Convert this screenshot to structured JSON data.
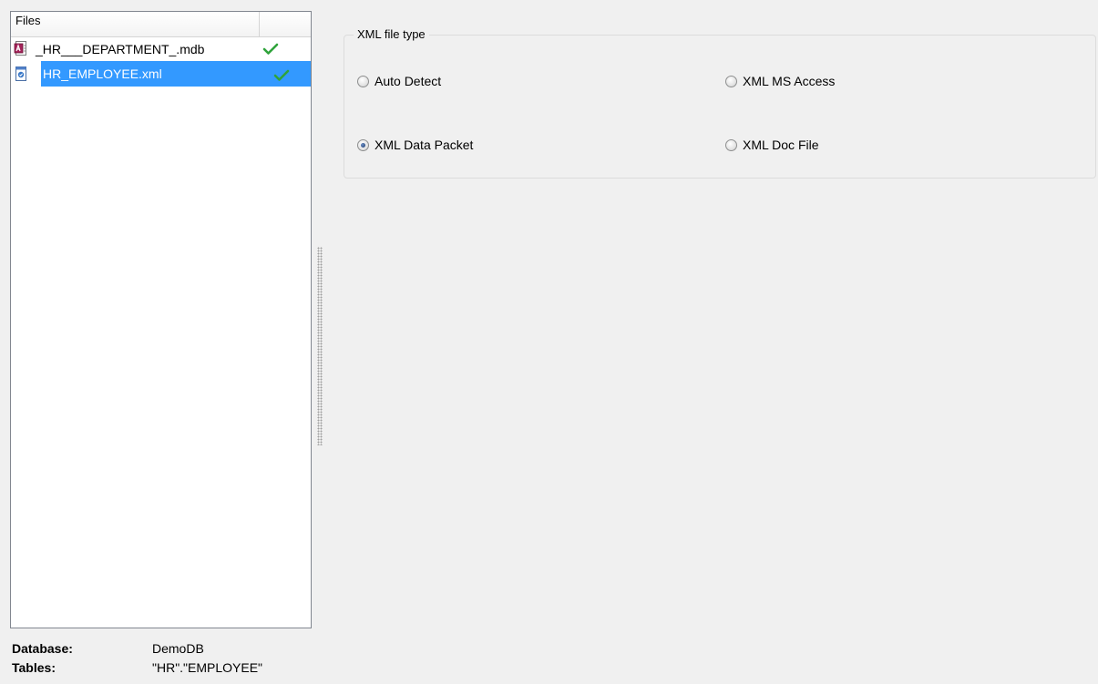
{
  "files_list": {
    "header": "Files",
    "items": [
      {
        "name": "_HR___DEPARTMENT_.mdb",
        "icon": "mdb-file-icon",
        "status": "checkmark-icon",
        "selected": false
      },
      {
        "name": "HR_EMPLOYEE.xml",
        "icon": "xml-file-icon",
        "status": "checkmark-icon",
        "selected": true
      }
    ]
  },
  "xml_file_type": {
    "title": "XML file type",
    "options": [
      {
        "label": "Auto Detect",
        "checked": false
      },
      {
        "label": "XML MS Access",
        "checked": false
      },
      {
        "label": "XML Data Packet",
        "checked": true
      },
      {
        "label": "XML Doc File",
        "checked": false
      }
    ]
  },
  "info": {
    "database_label": "Database:",
    "database_value": "DemoDB",
    "tables_label": "Tables:",
    "tables_value": "\"HR\".\"EMPLOYEE\""
  },
  "colors": {
    "selection": "#3399ff",
    "check_green": "#2fa33b",
    "background": "#f0f0f0"
  }
}
